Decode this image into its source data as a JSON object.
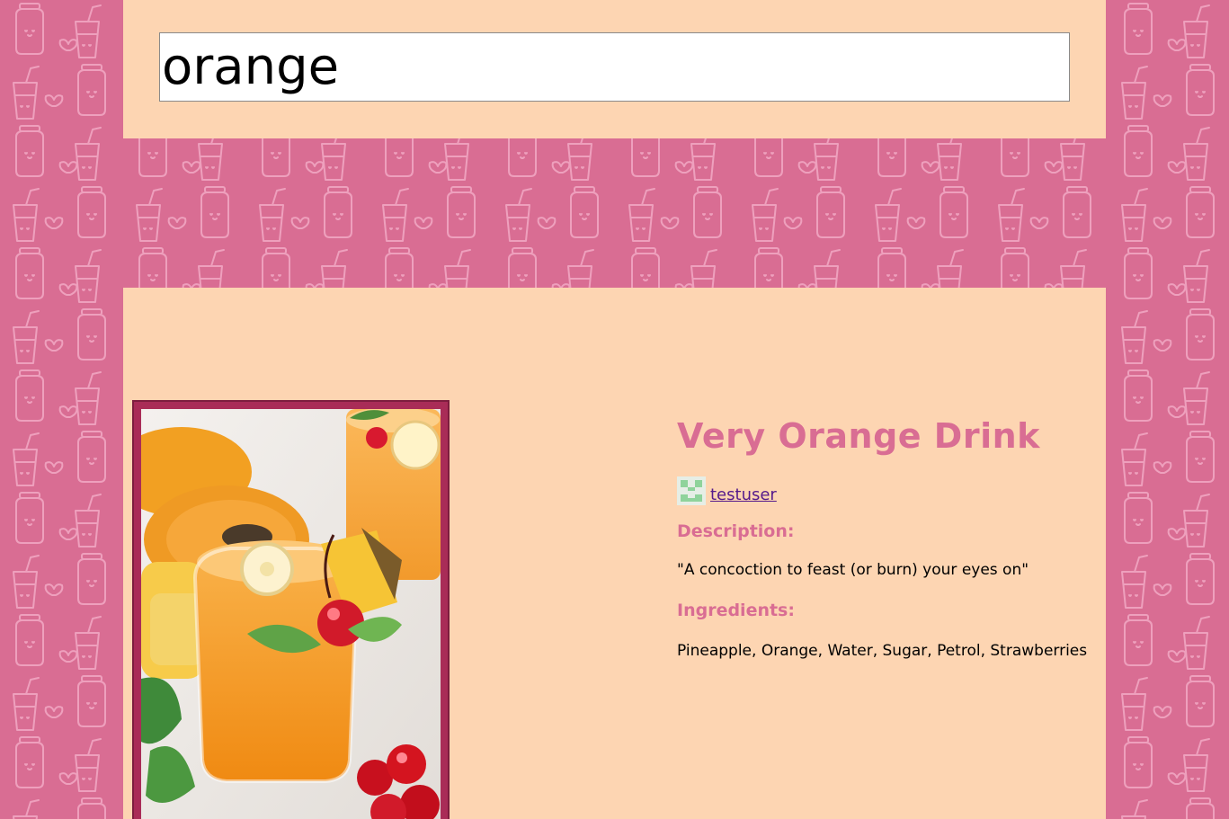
{
  "search": {
    "value": "orange",
    "placeholder": ""
  },
  "drink": {
    "title": "Very Orange Drink",
    "author": "testuser",
    "description_heading": "Description:",
    "description": "\"A concoction to feast (or burn) your eyes on\"",
    "ingredients_heading": "Ingredients:",
    "ingredients": "Pineapple, Orange, Water, Sugar, Petrol, Strawberries"
  },
  "colors": {
    "background": "#d96d93",
    "pattern": "#eea0bd",
    "panel": "#fdd5b2",
    "accent": "#d96d93",
    "frame": "#a92c57",
    "link": "#551a8b"
  },
  "icons": {
    "background_pattern": "smoothie-cup-pattern",
    "avatar": "identicon-avatar"
  }
}
